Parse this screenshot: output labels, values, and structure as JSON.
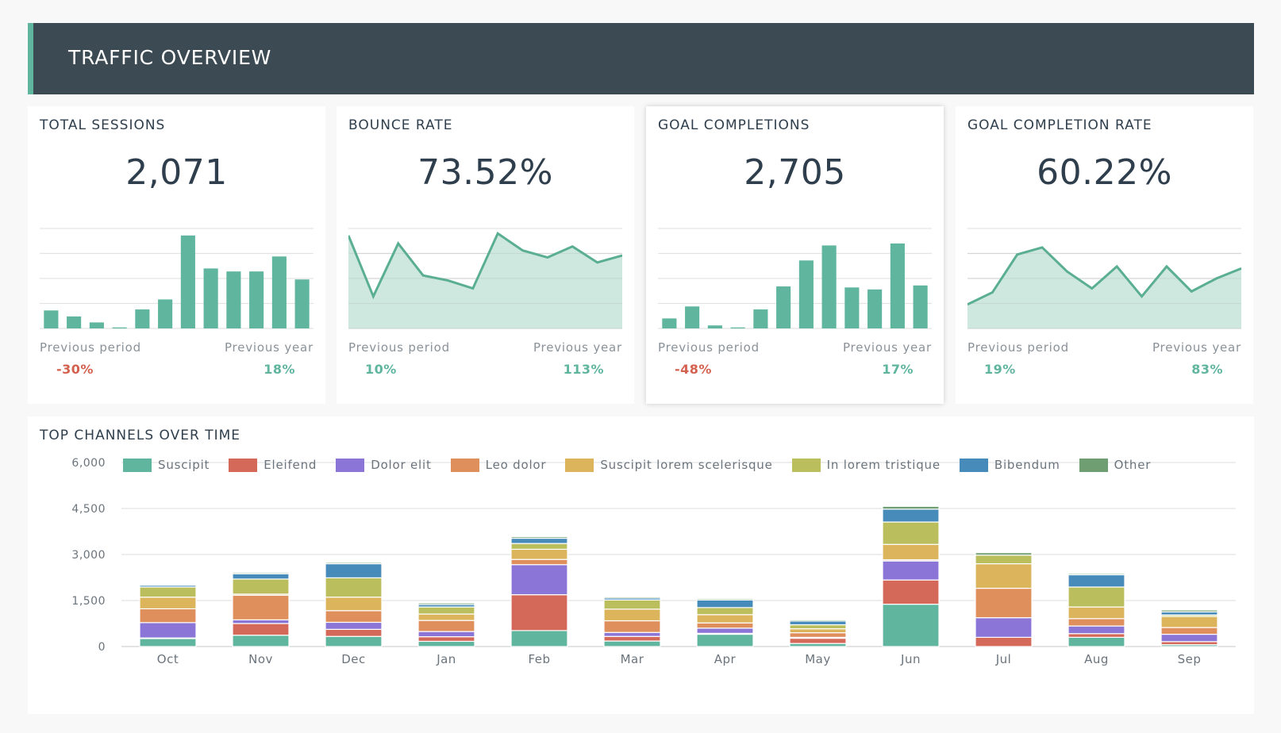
{
  "header": {
    "title": "TRAFFIC OVERVIEW"
  },
  "colors": {
    "accent": "#5fb59e",
    "negative": "#d4614f",
    "positive": "#5fb59e",
    "header_bg": "#3b4a53"
  },
  "kpis": [
    {
      "title": "TOTAL SESSIONS",
      "value": "2,071",
      "chart_type": "bar",
      "series": [
        18,
        12,
        6,
        1,
        19,
        29,
        93,
        60,
        57,
        57,
        72,
        49
      ],
      "previous_period_label": "Previous period",
      "previous_period_value": "-30%",
      "previous_period_sign": "neg",
      "previous_year_label": "Previous year",
      "previous_year_value": "18%",
      "previous_year_sign": "pos"
    },
    {
      "title": "BOUNCE RATE",
      "value": "73.52%",
      "chart_type": "area",
      "series": [
        93,
        32,
        85,
        53,
        48,
        40,
        95,
        78,
        71,
        82,
        66,
        73
      ],
      "previous_period_label": "Previous period",
      "previous_period_value": "10%",
      "previous_period_sign": "pos",
      "previous_year_label": "Previous year",
      "previous_year_value": "113%",
      "previous_year_sign": "pos"
    },
    {
      "title": "GOAL COMPLETIONS",
      "value": "2,705",
      "chart_type": "bar",
      "series": [
        10,
        22,
        3,
        1,
        19,
        42,
        68,
        83,
        41,
        39,
        85,
        43
      ],
      "previous_period_label": "Previous period",
      "previous_period_value": "-48%",
      "previous_period_sign": "neg",
      "previous_year_label": "Previous year",
      "previous_year_value": "17%",
      "previous_year_sign": "pos",
      "elevated": true
    },
    {
      "title": "GOAL COMPLETION RATE",
      "value": "60.22%",
      "chart_type": "area",
      "series": [
        24,
        36,
        74,
        81,
        57,
        40,
        62,
        32,
        62,
        37,
        50,
        60
      ],
      "previous_period_label": "Previous period",
      "previous_period_value": "19%",
      "previous_period_sign": "pos",
      "previous_year_label": "Previous year",
      "previous_year_value": "83%",
      "previous_year_sign": "pos"
    }
  ],
  "channels": {
    "title": "TOP CHANNELS OVER TIME"
  },
  "chart_data": {
    "type": "bar",
    "stacked": true,
    "title": "TOP CHANNELS OVER TIME",
    "xlabel": "",
    "ylabel": "",
    "ylim": [
      0,
      6000
    ],
    "yticks": [
      0,
      1500,
      3000,
      4500,
      6000
    ],
    "ytick_labels": [
      "0",
      "1,500",
      "3,000",
      "4,500",
      "6,000"
    ],
    "grid": true,
    "legend_position": "top",
    "categories": [
      "Oct",
      "Nov",
      "Dec",
      "Jan",
      "Feb",
      "Mar",
      "Apr",
      "May",
      "Jun",
      "Jul",
      "Aug",
      "Sep"
    ],
    "series": [
      {
        "name": "Suscipit",
        "color": "#60b59e",
        "values": [
          260,
          370,
          330,
          170,
          520,
          180,
          400,
          100,
          1380,
          0,
          300,
          60
        ]
      },
      {
        "name": "Eleifend",
        "color": "#d4695a",
        "values": [
          20,
          380,
          230,
          150,
          1170,
          150,
          30,
          170,
          790,
          300,
          120,
          100
        ]
      },
      {
        "name": "Dolor elit",
        "color": "#8b75d7",
        "values": [
          500,
          120,
          230,
          170,
          980,
          130,
          170,
          30,
          620,
          640,
          250,
          240
        ]
      },
      {
        "name": "Leo dolor",
        "color": "#de8f5b",
        "values": [
          450,
          800,
          380,
          360,
          170,
          380,
          170,
          150,
          40,
          960,
          240,
          220
        ]
      },
      {
        "name": "Suscipit lorem scelerisque",
        "color": "#dbb45c",
        "values": [
          380,
          40,
          440,
          210,
          330,
          380,
          270,
          130,
          500,
          800,
          380,
          360
        ]
      },
      {
        "name": "In lorem tristique",
        "color": "#bbbe5c",
        "values": [
          330,
          490,
          630,
          230,
          190,
          300,
          230,
          130,
          730,
          280,
          650,
          50
        ]
      },
      {
        "name": "Bibendum",
        "color": "#468bba",
        "values": [
          60,
          170,
          460,
          80,
          170,
          60,
          250,
          120,
          420,
          0,
          400,
          100
        ]
      },
      {
        "name": "Other",
        "color": "#6f9e72",
        "values": [
          30,
          40,
          40,
          50,
          50,
          40,
          40,
          40,
          90,
          80,
          40,
          60
        ]
      }
    ]
  }
}
